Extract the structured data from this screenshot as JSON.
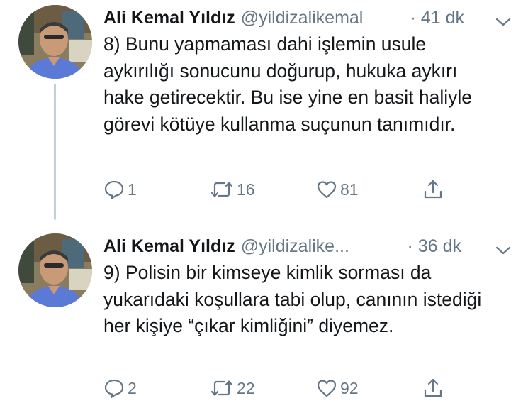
{
  "tweets": [
    {
      "author_name": "Ali Kemal Yıldız",
      "handle": "@yildizalikemal",
      "separator": "·",
      "time": "41 dk",
      "text": "8) Bunu yapmaması dahi işlemin usule aykırılığı sonucunu doğurup, hukuka aykırı hake getirecektir. Bu ise yine en basit haliyle görevi kötüye kullanma suçunun tanımıdır.",
      "replies": "1",
      "retweets": "16",
      "likes": "81"
    },
    {
      "author_name": "Ali Kemal Yıldız",
      "handle": "@yildizalike...",
      "separator": "·",
      "time": "36 dk",
      "text": "9) Polisin bir kimseye kimlik sorması da yukarıdaki koşullara tabi olup, canının istediği her kişiye “çıkar kimliğini” diyemez.",
      "replies": "2",
      "retweets": "22",
      "likes": "92"
    }
  ],
  "icons": {
    "reply": "reply-icon",
    "retweet": "retweet-icon",
    "like": "heart-icon",
    "share": "share-icon",
    "menu": "chevron-down-icon"
  },
  "colors": {
    "text_primary": "#14171a",
    "text_secondary": "#657786",
    "thread_line": "#c4cfd6"
  }
}
